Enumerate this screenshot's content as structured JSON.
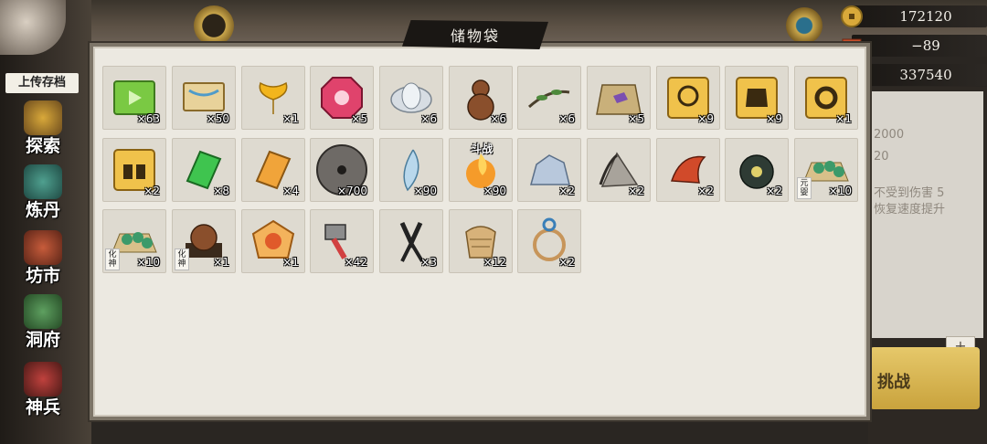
{
  "currency": [
    {
      "name": "gold-coin",
      "value": "172120",
      "color": "#d9a93a"
    },
    {
      "name": "brick",
      "value": "−89",
      "color": "#c8502c"
    },
    {
      "name": "spirit-stone",
      "value": "337540",
      "color": "#3fb3a6"
    }
  ],
  "left_nav": {
    "title": "上传存档",
    "items": [
      {
        "label": "探索",
        "icon": "lantern-icon"
      },
      {
        "label": "炼丹",
        "icon": "furnace-icon"
      },
      {
        "label": "坊市",
        "icon": "market-icon"
      },
      {
        "label": "洞府",
        "icon": "pagoda-icon"
      },
      {
        "label": "神兵",
        "icon": "weapon-icon"
      }
    ]
  },
  "right_background": {
    "lines": [
      "2000",
      "20",
      "不受到伤害 5",
      "恢复速度提升"
    ],
    "button_label": "挑战",
    "plus_label": "+"
  },
  "panel": {
    "title": "储物袋"
  },
  "items": [
    {
      "icon": "green-scroll",
      "count": "×63"
    },
    {
      "icon": "map-scroll",
      "count": "×50"
    },
    {
      "icon": "ginkgo-leaf",
      "count": "×1"
    },
    {
      "icon": "red-gem",
      "count": "×5"
    },
    {
      "icon": "white-lotus",
      "count": "×6"
    },
    {
      "icon": "gourd",
      "count": "×6"
    },
    {
      "icon": "green-branch",
      "count": "×6"
    },
    {
      "icon": "purple-ore-map",
      "count": "×5"
    },
    {
      "icon": "necklace-scroll",
      "count": "×9"
    },
    {
      "icon": "armor-scroll",
      "count": "×9"
    },
    {
      "icon": "ring-scroll",
      "count": "×1"
    },
    {
      "icon": "boots-scroll",
      "count": "×2"
    },
    {
      "icon": "green-talisman",
      "count": "×8"
    },
    {
      "icon": "orange-talisman",
      "count": "×4"
    },
    {
      "icon": "iron-disc",
      "count": "×700"
    },
    {
      "icon": "blue-feather",
      "count": "×90"
    },
    {
      "icon": "fire-orb",
      "count": "×90",
      "overtext": "斗战"
    },
    {
      "icon": "ice-rock",
      "count": "×2"
    },
    {
      "icon": "fang-stone",
      "count": "×2"
    },
    {
      "icon": "red-claw",
      "count": "×2"
    },
    {
      "icon": "black-lotus",
      "count": "×2"
    },
    {
      "icon": "jade-beads",
      "count": "×10",
      "badge": "元婴"
    },
    {
      "icon": "jade-beads",
      "count": "×10",
      "badge": "化神"
    },
    {
      "icon": "bronze-orb",
      "count": "×1",
      "badge": "化神"
    },
    {
      "icon": "flame-emblem",
      "count": "×1"
    },
    {
      "icon": "hammer",
      "count": "×42"
    },
    {
      "icon": "pliers",
      "count": "×3"
    },
    {
      "icon": "net-bag",
      "count": "×12"
    },
    {
      "icon": "rope-knot",
      "count": "×2"
    }
  ]
}
